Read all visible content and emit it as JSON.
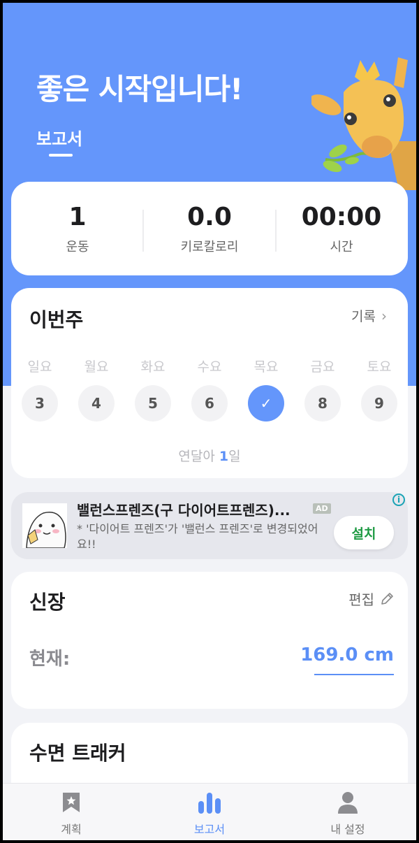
{
  "header": {
    "title": "좋은 시작입니다!",
    "tab": "보고서"
  },
  "stats": [
    {
      "value": "1",
      "label": "운동"
    },
    {
      "value": "0.0",
      "label": "키로칼로리"
    },
    {
      "value": "00:00",
      "label": "시간"
    }
  ],
  "week": {
    "title": "이번주",
    "record_link": "기록",
    "days": [
      {
        "label": "일요",
        "date": "3"
      },
      {
        "label": "월요",
        "date": "4"
      },
      {
        "label": "화요",
        "date": "5"
      },
      {
        "label": "수요",
        "date": "6"
      },
      {
        "label": "목요",
        "date": "✓"
      },
      {
        "label": "금요",
        "date": "8"
      },
      {
        "label": "토요",
        "date": "9"
      }
    ],
    "streak_prefix": "연달아 ",
    "streak_count": "1",
    "streak_suffix": "일"
  },
  "ad": {
    "title": "밸런스프렌즈(구 다이어트프렌즈)...",
    "badge": "AD",
    "info": "i",
    "desc": "* '다이어트 프렌즈'가 '밸런스 프렌즈'로 변경되었어요!!",
    "button": "설치"
  },
  "height": {
    "title": "신장",
    "edit": "편집",
    "current_label": "현재:",
    "value": "169.0 cm"
  },
  "sleep": {
    "title": "수면 트래커"
  },
  "nav": [
    {
      "label": "계획",
      "icon": "bookmark-star-icon"
    },
    {
      "label": "보고서",
      "icon": "bar-chart-icon"
    },
    {
      "label": "내 설정",
      "icon": "person-icon"
    }
  ],
  "colors": {
    "primary": "#6496fb",
    "background": "#f2f3f7",
    "install": "#1e9a43"
  }
}
